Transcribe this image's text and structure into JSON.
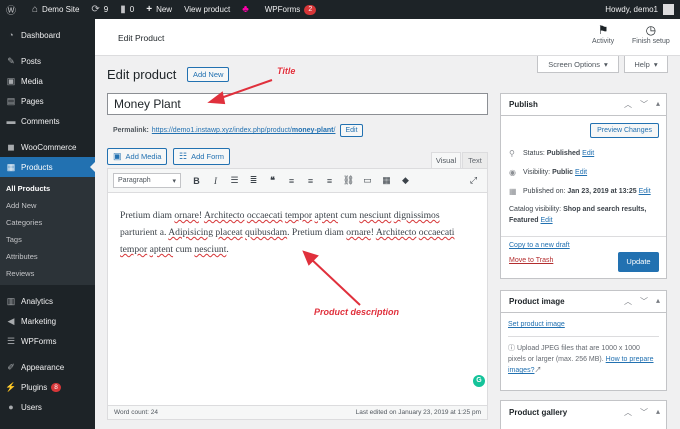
{
  "adminbar": {
    "site_name": "Demo Site",
    "updates_count": "9",
    "comments_count": "0",
    "new_label": "New",
    "view_product": "View product",
    "wpforms_label": "WPForms",
    "wpforms_badge": "2",
    "howdy": "Howdy, demo1"
  },
  "sidebar": {
    "items": [
      {
        "label": "Dashboard",
        "icon": "dashboard-icon"
      },
      {
        "label": "Posts",
        "icon": "pin-icon"
      },
      {
        "label": "Media",
        "icon": "media-icon"
      },
      {
        "label": "Pages",
        "icon": "page-icon"
      },
      {
        "label": "Comments",
        "icon": "comment-icon"
      },
      {
        "label": "WooCommerce",
        "icon": "woo-icon"
      },
      {
        "label": "Products",
        "icon": "archive-icon"
      },
      {
        "label": "Analytics",
        "icon": "chart-icon"
      },
      {
        "label": "Marketing",
        "icon": "megaphone-icon"
      },
      {
        "label": "WPForms",
        "icon": "forms-icon"
      },
      {
        "label": "Appearance",
        "icon": "brush-icon"
      },
      {
        "label": "Plugins",
        "icon": "plugin-icon",
        "badge": "8"
      },
      {
        "label": "Users",
        "icon": "user-icon"
      }
    ],
    "submenu": [
      "All Products",
      "Add New",
      "Categories",
      "Tags",
      "Attributes",
      "Reviews"
    ]
  },
  "header": {
    "title": "Edit Product",
    "activity": "Activity",
    "finish_setup": "Finish setup",
    "screen_options": "Screen Options",
    "help": "Help"
  },
  "main": {
    "page_title": "Edit product",
    "add_new": "Add New",
    "product_title": "Money Plant",
    "permalink_label": "Permalink:",
    "permalink_base": "https://demo1.instawp.xyz/index.php/product/",
    "permalink_slug": "money-plant",
    "permalink_end": "/",
    "permalink_edit": "Edit",
    "add_media": "Add Media",
    "add_form": "Add Form",
    "tab_visual": "Visual",
    "tab_text": "Text",
    "format_select": "Paragraph",
    "content": {
      "w1": "Pretium diam",
      "w2": "ornare",
      "w3": "!",
      "w4": "Architecto",
      "w5": "occaecati",
      "w6": "tempor",
      "w7": "aptent",
      "w8": "cum",
      "w9": "nesciunt",
      "w10": "dignissimos",
      "w11": "parturient a.",
      "w12": "Adipisicing",
      "w13": "placeat",
      "w14": "quibusdam",
      "w15": ". Pretium diam",
      "w16": "ornare",
      "w17": "!",
      "w18": "Architecto",
      "w19": "occaecati",
      "w20": "tempor",
      "w21": "aptent",
      "w22": "cum",
      "w23": "nesciunt",
      "w24": "."
    },
    "word_count": "Word count: 24",
    "last_edited": "Last edited on January 23, 2019 at 1:25 pm"
  },
  "publish": {
    "title": "Publish",
    "preview": "Preview Changes",
    "status_label": "Status:",
    "status_value": "Published",
    "visibility_label": "Visibility:",
    "visibility_value": "Public",
    "published_on_label": "Published on:",
    "published_on_value": "Jan 23, 2019 at 13:25",
    "edit": "Edit",
    "catalog_label": "Catalog visibility:",
    "catalog_value": "Shop and search results, Featured",
    "copy_draft": "Copy to a new draft",
    "trash": "Move to Trash",
    "update": "Update"
  },
  "product_image": {
    "title": "Product image",
    "set_link": "Set product image",
    "note": "Upload JPEG files that are 1000 x 1000 pixels or larger (max. 256 MB).",
    "how_link": "How to prepare images?"
  },
  "product_gallery": {
    "title": "Product gallery"
  },
  "annotations": {
    "title": "Title",
    "description": "Product description"
  },
  "colors": {
    "accent": "#2271b1",
    "adminbar": "#1d2327",
    "annotation": "#e0303c"
  }
}
